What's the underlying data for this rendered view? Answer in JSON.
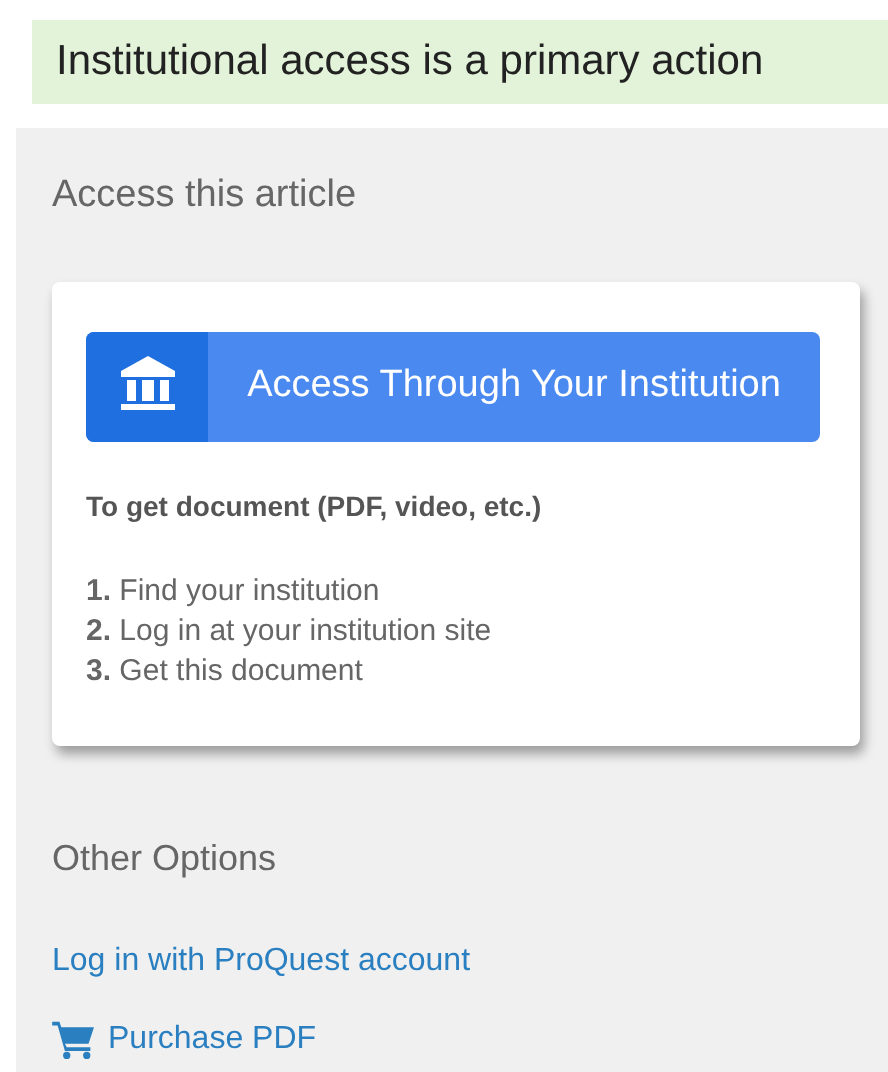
{
  "caption": "Institutional access is a primary action",
  "panel": {
    "title": "Access this article",
    "card": {
      "button": "Access Through Your Institution",
      "instructions_title": "To get document (PDF, video, etc.)",
      "steps": [
        "**1.** Find your institution",
        "**2.** Log in at your institution site",
        "**3.** Get this document"
      ]
    },
    "other_options": {
      "title": "Other Options",
      "links": [
        {
          "kind": "text",
          "label": "Log in with ProQuest account"
        },
        {
          "kind": "cart",
          "label": "Purchase PDF"
        }
      ]
    }
  }
}
